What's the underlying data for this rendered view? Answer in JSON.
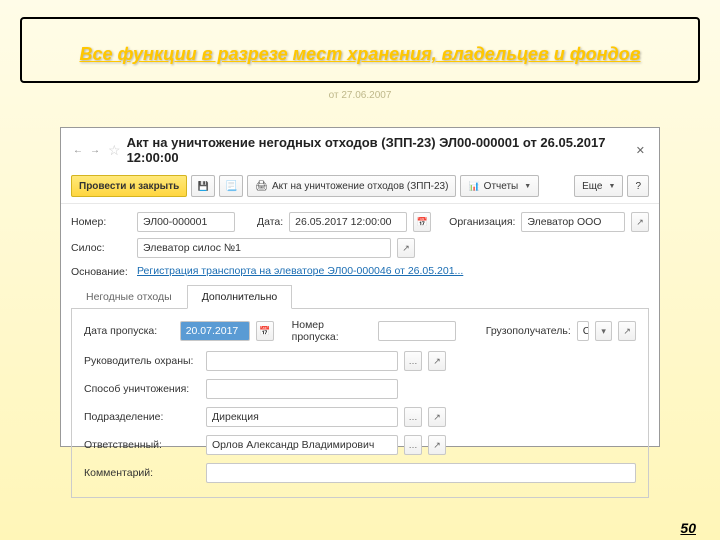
{
  "heading": {
    "title": "Все функции в разрезе мест хранения, владельцев и фондов",
    "subtitle": "от 27.06.2007"
  },
  "page_number": "50",
  "window": {
    "title": "Акт на уничтожение негодных отходов (ЗПП-23) ЭЛ00-000001 от 26.05.2017 12:00:00"
  },
  "toolbar": {
    "post_close": "Провести и закрыть",
    "print_act": "Акт на уничтожение отходов (ЗПП-23)",
    "reports": "Отчеты",
    "more": "Еще",
    "help": "?"
  },
  "header_form": {
    "number_label": "Номер:",
    "number_value": "ЭЛ00-000001",
    "date_label": "Дата:",
    "date_value": "26.05.2017 12:00:00",
    "org_label": "Организация:",
    "org_value": "Элеватор ООО",
    "silo_label": "Силос:",
    "silo_value": "Элеватор силос №1",
    "basis_label": "Основание:",
    "basis_link": "Регистрация транспорта на элеваторе ЭЛ00-000046 от 26.05.201..."
  },
  "tabs": {
    "tab1": "Негодные отходы",
    "tab2": "Дополнительно"
  },
  "extra": {
    "pass_date_label": "Дата пропуска:",
    "pass_date_value": "20.07.2017",
    "pass_no_label": "Номер пропуска:",
    "pass_no_value": "",
    "consignee_label": "Грузополучатель:",
    "consignee_value": "Свалка",
    "guard_label": "Руководитель охраны:",
    "guard_value": "",
    "method_label": "Способ уничтожения:",
    "method_value": "",
    "dept_label": "Подразделение:",
    "dept_value": "Дирекция",
    "responsible_label": "Ответственный:",
    "responsible_value": "Орлов Александр Владимирович",
    "comment_label": "Комментарий:",
    "comment_value": ""
  }
}
